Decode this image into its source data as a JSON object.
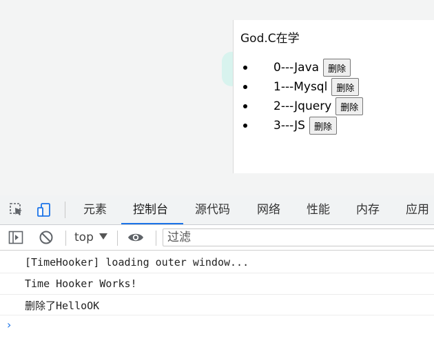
{
  "page": {
    "title": "God.C在学",
    "items": [
      {
        "text": "0---Java",
        "button": "删除"
      },
      {
        "text": "1---Mysql",
        "button": "删除"
      },
      {
        "text": "2---Jquery",
        "button": "删除"
      },
      {
        "text": "3---JS",
        "button": "删除"
      }
    ]
  },
  "devtools": {
    "tabs": [
      "元素",
      "控制台",
      "源代码",
      "网络",
      "性能",
      "内存",
      "应用"
    ],
    "active_tab": "控制台",
    "context": "top",
    "filter_placeholder": "过滤",
    "logs": [
      "[TimeHooker] loading outer window...",
      "Time Hooker Works!",
      "删除了HelloOK"
    ],
    "prompt_symbol": "›",
    "accent_color": "#1a73e8"
  }
}
